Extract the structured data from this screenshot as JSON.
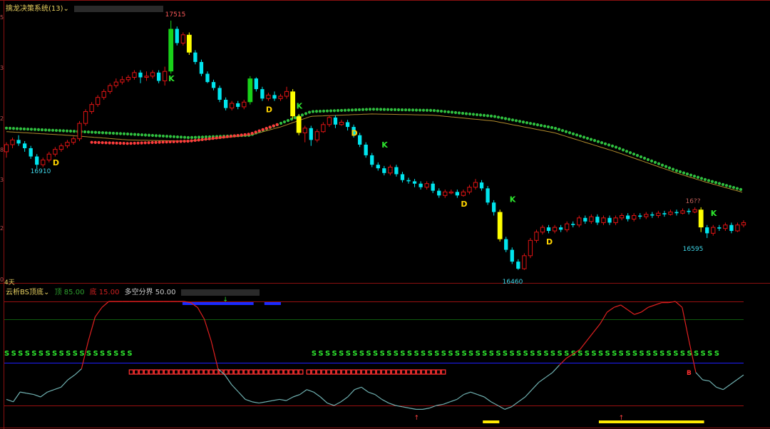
{
  "top_panel": {
    "title": "擒龙决策系统(13)",
    "chevron": "⌄",
    "period": "4天"
  },
  "bottom_panel": {
    "title": "云析BS顶底",
    "chevron": "⌄",
    "label_top": "顶 85.00",
    "label_bottom": "底 15.00",
    "label_mid": "多空分界 50.00"
  },
  "colors": {
    "up_candle": "#e01414",
    "down_candle": "#00e5ee",
    "strong_up": "#19d219",
    "strong_down": "#ffff00",
    "dot_green": "#2fbf3f",
    "dot_red": "#ff3c3c",
    "thin_line": "#b08a2c",
    "osc_red": "#e02020",
    "osc_cyan": "#6fb0b0",
    "letter_d": "#ffd400",
    "letter_k": "#2ee62e",
    "label_low": "#3fd6e8",
    "label_high": "#ff5a5a",
    "s_green": "#2ee62e",
    "b_red": "#ff3030",
    "bar_blue": "#1a2aff",
    "bar_yellow": "#ffea00",
    "ref_red": "#9a1010",
    "ref_green": "#0f5a0f",
    "ref_blue": "#2020ff"
  },
  "chart_data": [
    {
      "type": "candlestick",
      "annotations": {
        "high": "17515",
        "low": "16460",
        "low_left": "16910",
        "low_right": "16595",
        "right_tag": "16??"
      },
      "y_ticks": [
        "5",
        "3",
        "2",
        "8",
        "3",
        "2",
        "0"
      ],
      "price_range": [
        16420,
        17560
      ],
      "candles": [
        [
          16960,
          16990,
          16935,
          17000
        ],
        [
          16990,
          17010,
          16975,
          17020
        ],
        [
          17010,
          16995,
          16985,
          17030
        ],
        [
          16995,
          16975,
          16960,
          17005
        ],
        [
          16975,
          16940,
          16930,
          16985
        ],
        [
          16940,
          16905,
          16890,
          16950
        ],
        [
          16905,
          16925,
          16895,
          16935
        ],
        [
          16925,
          16950,
          16915,
          16960
        ],
        [
          16950,
          16970,
          16940,
          16980
        ],
        [
          16970,
          16985,
          16960,
          16995
        ],
        [
          16985,
          17000,
          16975,
          17010
        ],
        [
          17000,
          17015,
          16990,
          17025
        ],
        [
          17015,
          17080,
          17005,
          17090
        ],
        [
          17080,
          17130,
          17070,
          17140
        ],
        [
          17130,
          17160,
          17120,
          17170
        ],
        [
          17160,
          17190,
          17150,
          17200
        ],
        [
          17190,
          17215,
          17180,
          17225
        ],
        [
          17215,
          17240,
          17205,
          17250
        ],
        [
          17240,
          17255,
          17230,
          17270
        ],
        [
          17255,
          17265,
          17245,
          17280
        ],
        [
          17265,
          17275,
          17255,
          17285
        ],
        [
          17275,
          17295,
          17265,
          17305
        ],
        [
          17295,
          17275,
          17250,
          17305
        ],
        [
          17275,
          17280,
          17260,
          17300
        ],
        [
          17280,
          17295,
          17270,
          17305
        ],
        [
          17295,
          17260,
          17250,
          17305
        ],
        [
          17260,
          17300,
          17240,
          17320
        ],
        [
          17300,
          17480,
          17290,
          17515
        ],
        [
          17480,
          17420,
          17410,
          17490
        ],
        [
          17420,
          17455,
          17410,
          17465
        ],
        [
          17455,
          17380,
          17370,
          17465
        ],
        [
          17380,
          17340,
          17330,
          17390
        ],
        [
          17340,
          17290,
          17280,
          17350
        ],
        [
          17290,
          17255,
          17250,
          17300
        ],
        [
          17255,
          17230,
          17220,
          17265
        ],
        [
          17230,
          17180,
          17170,
          17240
        ],
        [
          17180,
          17145,
          17135,
          17190
        ],
        [
          17145,
          17165,
          17135,
          17175
        ],
        [
          17165,
          17150,
          17140,
          17175
        ],
        [
          17150,
          17170,
          17140,
          17180
        ],
        [
          17170,
          17270,
          17160,
          17280
        ],
        [
          17270,
          17225,
          17215,
          17275
        ],
        [
          17225,
          17185,
          17175,
          17235
        ],
        [
          17185,
          17200,
          17175,
          17210
        ],
        [
          17200,
          17185,
          17175,
          17215
        ],
        [
          17185,
          17195,
          17175,
          17205
        ],
        [
          17195,
          17215,
          17185,
          17235
        ],
        [
          17215,
          17110,
          17100,
          17225
        ],
        [
          17110,
          17040,
          17030,
          17120
        ],
        [
          17040,
          17060,
          17000,
          17070
        ],
        [
          17060,
          17010,
          16985,
          17070
        ],
        [
          17010,
          17045,
          17000,
          17055
        ],
        [
          17045,
          17075,
          17040,
          17085
        ],
        [
          17075,
          17105,
          17065,
          17115
        ],
        [
          17105,
          17075,
          17060,
          17115
        ],
        [
          17075,
          17085,
          17070,
          17095
        ],
        [
          17085,
          17065,
          17050,
          17095
        ],
        [
          17065,
          17030,
          17020,
          17075
        ],
        [
          17030,
          16990,
          16980,
          17040
        ],
        [
          16990,
          16945,
          16935,
          17000
        ],
        [
          16945,
          16905,
          16895,
          16955
        ],
        [
          16905,
          16890,
          16880,
          16915
        ],
        [
          16890,
          16870,
          16860,
          16900
        ],
        [
          16870,
          16895,
          16860,
          16905
        ],
        [
          16895,
          16865,
          16855,
          16905
        ],
        [
          16865,
          16840,
          16830,
          16875
        ],
        [
          16840,
          16835,
          16825,
          16850
        ],
        [
          16835,
          16825,
          16810,
          16845
        ],
        [
          16825,
          16810,
          16800,
          16835
        ],
        [
          16810,
          16825,
          16800,
          16835
        ],
        [
          16825,
          16795,
          16785,
          16835
        ],
        [
          16795,
          16775,
          16765,
          16805
        ],
        [
          16775,
          16790,
          16765,
          16800
        ],
        [
          16790,
          16790,
          16780,
          16800
        ],
        [
          16790,
          16775,
          16765,
          16800
        ],
        [
          16775,
          16790,
          16770,
          16800
        ],
        [
          16790,
          16810,
          16780,
          16820
        ],
        [
          16810,
          16830,
          16800,
          16845
        ],
        [
          16830,
          16805,
          16795,
          16840
        ],
        [
          16805,
          16745,
          16735,
          16815
        ],
        [
          16745,
          16705,
          16690,
          16755
        ],
        [
          16705,
          16590,
          16580,
          16715
        ],
        [
          16590,
          16545,
          16535,
          16600
        ],
        [
          16545,
          16495,
          16485,
          16555
        ],
        [
          16495,
          16465,
          16460,
          16505
        ],
        [
          16465,
          16520,
          16460,
          16530
        ],
        [
          16520,
          16585,
          16510,
          16595
        ],
        [
          16585,
          16620,
          16575,
          16630
        ],
        [
          16620,
          16640,
          16610,
          16650
        ],
        [
          16640,
          16625,
          16615,
          16650
        ],
        [
          16625,
          16640,
          16615,
          16650
        ],
        [
          16640,
          16630,
          16620,
          16650
        ],
        [
          16630,
          16655,
          16620,
          16665
        ],
        [
          16655,
          16650,
          16640,
          16665
        ],
        [
          16650,
          16680,
          16640,
          16690
        ],
        [
          16680,
          16665,
          16655,
          16690
        ],
        [
          16665,
          16685,
          16655,
          16695
        ],
        [
          16685,
          16660,
          16650,
          16695
        ],
        [
          16660,
          16680,
          16650,
          16690
        ],
        [
          16680,
          16660,
          16650,
          16690
        ],
        [
          16660,
          16680,
          16650,
          16690
        ],
        [
          16680,
          16690,
          16670,
          16700
        ],
        [
          16690,
          16675,
          16665,
          16700
        ],
        [
          16675,
          16690,
          16665,
          16700
        ],
        [
          16690,
          16685,
          16675,
          16700
        ],
        [
          16685,
          16695,
          16675,
          16705
        ],
        [
          16695,
          16690,
          16680,
          16705
        ],
        [
          16690,
          16700,
          16680,
          16710
        ],
        [
          16700,
          16695,
          16685,
          16710
        ],
        [
          16695,
          16705,
          16690,
          16715
        ],
        [
          16705,
          16700,
          16690,
          16715
        ],
        [
          16700,
          16710,
          16695,
          16720
        ],
        [
          16710,
          16705,
          16695,
          16720
        ],
        [
          16705,
          16715,
          16700,
          16725
        ],
        [
          16715,
          16640,
          16620,
          16725
        ],
        [
          16640,
          16615,
          16595,
          16650
        ],
        [
          16615,
          16640,
          16605,
          16650
        ],
        [
          16640,
          16635,
          16625,
          16650
        ],
        [
          16635,
          16650,
          16625,
          16660
        ],
        [
          16650,
          16625,
          16615,
          16660
        ],
        [
          16625,
          16650,
          16620,
          16660
        ],
        [
          16650,
          16660,
          16640,
          16670
        ]
      ],
      "ma_green_dots": [
        [
          0,
          17060
        ],
        [
          10,
          17048
        ],
        [
          20,
          17035
        ],
        [
          30,
          17020
        ],
        [
          40,
          17030
        ],
        [
          45,
          17080
        ],
        [
          50,
          17130
        ],
        [
          60,
          17140
        ],
        [
          70,
          17135
        ],
        [
          80,
          17110
        ],
        [
          90,
          17060
        ],
        [
          100,
          16980
        ],
        [
          110,
          16880
        ],
        [
          115,
          16840
        ],
        [
          122,
          16790
        ]
      ],
      "ma_red_dots": [
        [
          14,
          17000
        ],
        [
          20,
          16995
        ],
        [
          30,
          17005
        ],
        [
          40,
          17035
        ],
        [
          45,
          17080
        ]
      ],
      "ma_thin_line": [
        [
          0,
          17045
        ],
        [
          10,
          17030
        ],
        [
          20,
          17010
        ],
        [
          30,
          17005
        ],
        [
          40,
          17030
        ],
        [
          45,
          17065
        ],
        [
          50,
          17110
        ],
        [
          60,
          17120
        ],
        [
          70,
          17115
        ],
        [
          80,
          17090
        ],
        [
          90,
          17040
        ],
        [
          100,
          16960
        ],
        [
          110,
          16870
        ],
        [
          115,
          16830
        ],
        [
          122,
          16780
        ]
      ],
      "letters": [
        {
          "t": "D",
          "i": 7,
          "p": 16915
        },
        {
          "t": "K",
          "i": 26,
          "p": 17270
        },
        {
          "t": "D",
          "i": 42,
          "p": 17140
        },
        {
          "t": "K",
          "i": 47,
          "p": 17155
        },
        {
          "t": "D",
          "i": 56,
          "p": 17040
        },
        {
          "t": "K",
          "i": 61,
          "p": 16990
        },
        {
          "t": "D",
          "i": 74,
          "p": 16740
        },
        {
          "t": "K",
          "i": 82,
          "p": 16760
        },
        {
          "t": "D",
          "i": 88,
          "p": 16580
        },
        {
          "t": "K",
          "i": 115,
          "p": 16700
        }
      ]
    },
    {
      "type": "line",
      "name": "BS oscillator",
      "ylim": [
        0,
        100
      ],
      "ref_lines": [
        85,
        70,
        50,
        15
      ],
      "series": [
        {
          "name": "osc",
          "values": [
            20,
            18,
            26,
            25,
            24,
            22,
            26,
            28,
            30,
            36,
            40,
            45,
            60,
            72,
            80,
            86,
            88,
            90,
            91,
            92,
            93,
            94,
            92,
            90,
            88,
            86,
            88,
            84,
            80,
            70,
            60,
            45,
            40,
            32,
            26,
            20,
            18,
            17,
            18,
            19,
            20,
            19,
            22,
            24,
            28,
            26,
            22,
            17,
            15,
            18,
            22,
            28,
            30,
            26,
            24,
            20,
            17,
            15,
            14,
            13,
            12,
            12,
            13,
            15,
            16,
            18,
            20,
            24,
            26,
            24,
            22,
            18,
            15,
            12,
            14,
            18,
            22,
            28,
            34,
            38,
            42,
            48,
            52,
            54,
            56,
            60,
            64,
            68,
            76,
            80,
            82,
            78,
            74,
            76,
            80,
            82,
            84,
            84,
            86,
            80,
            60,
            42,
            36,
            35,
            30,
            28,
            32,
            36,
            40
          ]
        }
      ],
      "s_ranges": [
        [
          0,
          18
        ],
        [
          45,
          104
        ]
      ],
      "b_ranges": [
        [
          18,
          43
        ],
        [
          44,
          64
        ]
      ],
      "blue_ranges": [
        [
          26,
          36
        ],
        [
          38,
          40
        ]
      ],
      "yellow_ranges": [
        [
          70,
          72
        ],
        [
          87,
          102
        ],
        [
          113,
          118
        ]
      ],
      "up_arrows": [
        60,
        90,
        121
      ],
      "green_down_arrow": 32
    }
  ]
}
